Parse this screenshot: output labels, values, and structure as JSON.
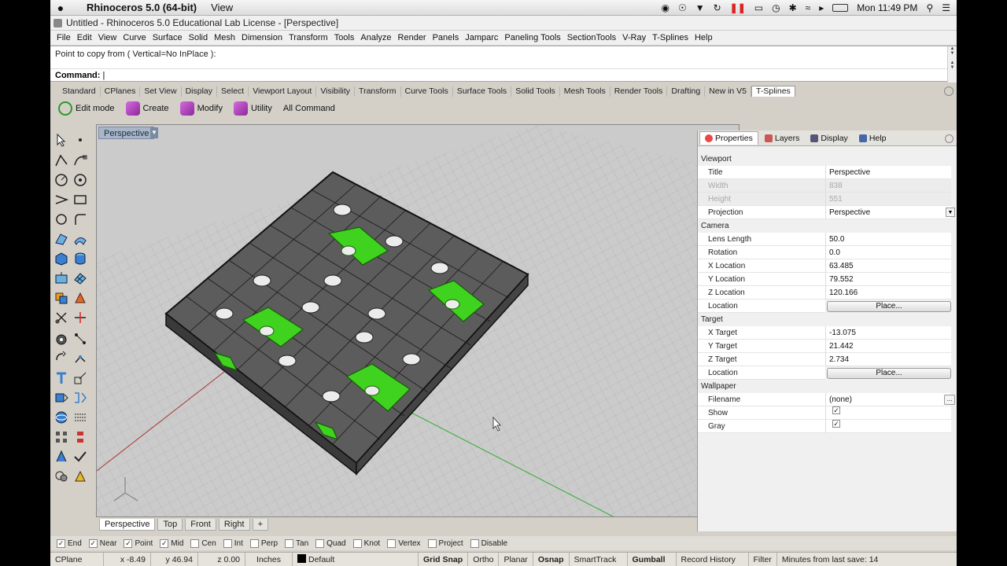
{
  "mac": {
    "app_name": "Rhinoceros 5.0 (64-bit)",
    "menu_view": "View",
    "clock": "Mon 11:49 PM"
  },
  "window": {
    "title": "Untitled - Rhinoceros 5.0 Educational Lab License - [Perspective]"
  },
  "menu": [
    "File",
    "Edit",
    "View",
    "Curve",
    "Surface",
    "Solid",
    "Mesh",
    "Dimension",
    "Transform",
    "Tools",
    "Analyze",
    "Render",
    "Panels",
    "Jamparc",
    "Paneling Tools",
    "SectionTools",
    "V-Ray",
    "T-Splines",
    "Help"
  ],
  "command": {
    "history": "Point to copy from ( Vertical=No  InPlace ):",
    "prompt_label": "Command:",
    "prompt_value": ""
  },
  "toolbar_tabs": [
    "Standard",
    "CPlanes",
    "Set View",
    "Display",
    "Select",
    "Viewport Layout",
    "Visibility",
    "Transform",
    "Curve Tools",
    "Surface Tools",
    "Solid Tools",
    "Mesh Tools",
    "Render Tools",
    "Drafting",
    "New in V5",
    "T-Splines"
  ],
  "tsplines_toolbar": {
    "edit_mode": "Edit mode",
    "create": "Create",
    "modify": "Modify",
    "utility": "Utility",
    "all_command": "All Command"
  },
  "viewport": {
    "title": "Perspective",
    "tabs": [
      "Perspective",
      "Top",
      "Front",
      "Right"
    ],
    "add_tab": "+"
  },
  "panel": {
    "tabs": [
      "Properties",
      "Layers",
      "Display",
      "Help"
    ],
    "sections": {
      "viewport": "Viewport",
      "camera": "Camera",
      "target": "Target",
      "wallpaper": "Wallpaper"
    },
    "viewport_rows": [
      {
        "label": "Title",
        "value": "Perspective"
      },
      {
        "label": "Width",
        "value": "838"
      },
      {
        "label": "Height",
        "value": "551"
      },
      {
        "label": "Projection",
        "value": "Perspective"
      }
    ],
    "camera_rows": [
      {
        "label": "Lens Length",
        "value": "50.0"
      },
      {
        "label": "Rotation",
        "value": "0.0"
      },
      {
        "label": "X Location",
        "value": "63.485"
      },
      {
        "label": "Y Location",
        "value": "79.552"
      },
      {
        "label": "Z Location",
        "value": "120.166"
      },
      {
        "label": "Location",
        "value": "Place..."
      }
    ],
    "target_rows": [
      {
        "label": "X Target",
        "value": "-13.075"
      },
      {
        "label": "Y Target",
        "value": "21.442"
      },
      {
        "label": "Z Target",
        "value": "2.734"
      },
      {
        "label": "Location",
        "value": "Place..."
      }
    ],
    "wallpaper_rows": [
      {
        "label": "Filename",
        "value": "(none)"
      },
      {
        "label": "Show",
        "value": "✓"
      },
      {
        "label": "Gray",
        "value": "✓"
      }
    ]
  },
  "osnap": [
    {
      "label": "End",
      "checked": true
    },
    {
      "label": "Near",
      "checked": true
    },
    {
      "label": "Point",
      "checked": true
    },
    {
      "label": "Mid",
      "checked": true
    },
    {
      "label": "Cen",
      "checked": false
    },
    {
      "label": "Int",
      "checked": false
    },
    {
      "label": "Perp",
      "checked": false
    },
    {
      "label": "Tan",
      "checked": false
    },
    {
      "label": "Quad",
      "checked": false
    },
    {
      "label": "Knot",
      "checked": false
    },
    {
      "label": "Vertex",
      "checked": false
    },
    {
      "label": "Project",
      "checked": false
    },
    {
      "label": "Disable",
      "checked": false
    }
  ],
  "status": {
    "cplane": "CPlane",
    "x": "x -8.49",
    "y": "y 46.94",
    "z": "z 0.00",
    "units": "Inches",
    "layer": "Default",
    "grid_snap": "Grid Snap",
    "ortho": "Ortho",
    "planar": "Planar",
    "osnap": "Osnap",
    "smarttrack": "SmartTrack",
    "gumball": "Gumball",
    "record_history": "Record History",
    "filter": "Filter",
    "save_info": "Minutes from last save: 14"
  },
  "colors": {
    "selected_green": "#3fd21e",
    "model_gray": "#6e6e6e",
    "viewport_bg": "#c8c8c8"
  }
}
